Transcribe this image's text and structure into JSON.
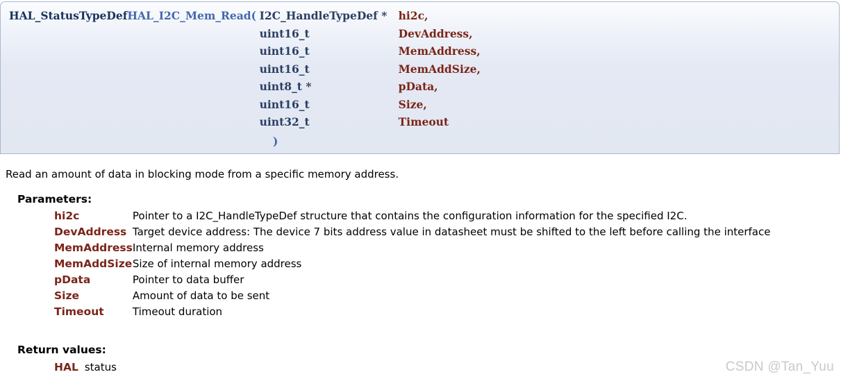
{
  "prototype": {
    "return_type": "HAL_StatusTypeDef",
    "function_name": "HAL_I2C_Mem_Read",
    "open_paren": "(",
    "close_paren": ")",
    "arguments": [
      {
        "type": "I2C_HandleTypeDef *",
        "name": "hi2c,"
      },
      {
        "type": "uint16_t",
        "name": "DevAddress,"
      },
      {
        "type": "uint16_t",
        "name": "MemAddress,"
      },
      {
        "type": "uint16_t",
        "name": "MemAddSize,"
      },
      {
        "type": "uint8_t *",
        "name": "pData,"
      },
      {
        "type": "uint16_t",
        "name": "Size,"
      },
      {
        "type": "uint32_t",
        "name": "Timeout"
      }
    ]
  },
  "description": "Read an amount of data in blocking mode from a specific memory address.",
  "parameters_section": {
    "title": "Parameters:",
    "rows": [
      {
        "name": "hi2c",
        "desc": "Pointer to a I2C_HandleTypeDef structure that contains the configuration information for the specified I2C."
      },
      {
        "name": "DevAddress",
        "desc": "Target device address: The device 7 bits address value in datasheet must be shifted to the left before calling the interface"
      },
      {
        "name": "MemAddress",
        "desc": "Internal memory address"
      },
      {
        "name": "MemAddSize",
        "desc": "Size of internal memory address"
      },
      {
        "name": "pData",
        "desc": "Pointer to data buffer"
      },
      {
        "name": "Size",
        "desc": "Amount of data to be sent"
      },
      {
        "name": "Timeout",
        "desc": "Timeout duration"
      }
    ]
  },
  "returns_section": {
    "title": "Return values:",
    "rows": [
      {
        "name": "HAL",
        "desc": "status"
      }
    ]
  },
  "watermark": "CSDN @Tan_Yuu",
  "colors": {
    "return_type": "#16335b",
    "function_name": "#4467ac",
    "arg_type": "#2b3f63",
    "arg_name": "#7a2518",
    "param_key": "#7a2518",
    "box_border": "#a8b8d0",
    "box_bg": "#e2e7f2",
    "watermark": "#c9c9c9"
  }
}
